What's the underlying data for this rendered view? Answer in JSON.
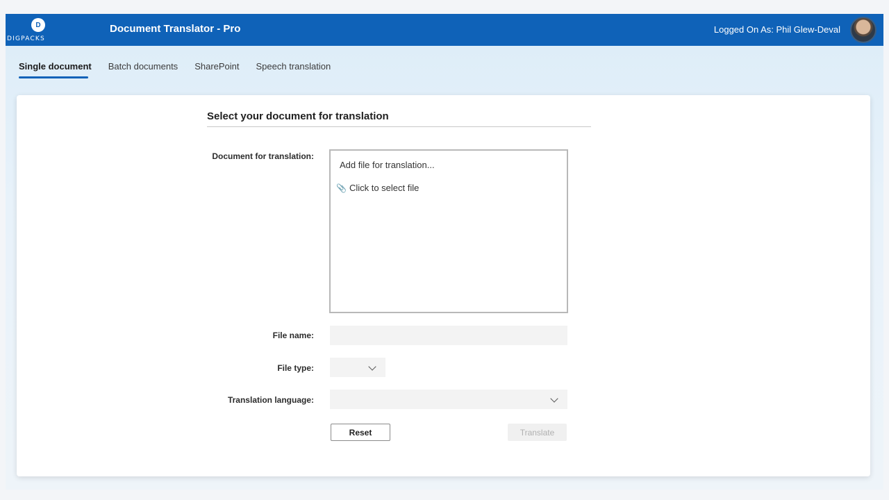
{
  "header": {
    "logo_text": "DIGPACKS",
    "logo_mark": "D",
    "app_title": "Document Translator - Pro",
    "user_label": "Logged On As: Phil Glew-Deval"
  },
  "tabs": [
    {
      "label": "Single document",
      "active": true
    },
    {
      "label": "Batch documents",
      "active": false
    },
    {
      "label": "SharePoint",
      "active": false
    },
    {
      "label": "Speech translation",
      "active": false
    }
  ],
  "form": {
    "section_title": "Select your document for translation",
    "document_label": "Document for translation:",
    "dropzone_title": "Add file for translation...",
    "dropzone_action": "Click to select file",
    "file_name_label": "File name:",
    "file_name_value": "",
    "file_type_label": "File type:",
    "file_type_value": "",
    "language_label": "Translation language:",
    "language_value": "",
    "reset_label": "Reset",
    "translate_label": "Translate"
  },
  "colors": {
    "brand": "#0f62b8"
  }
}
